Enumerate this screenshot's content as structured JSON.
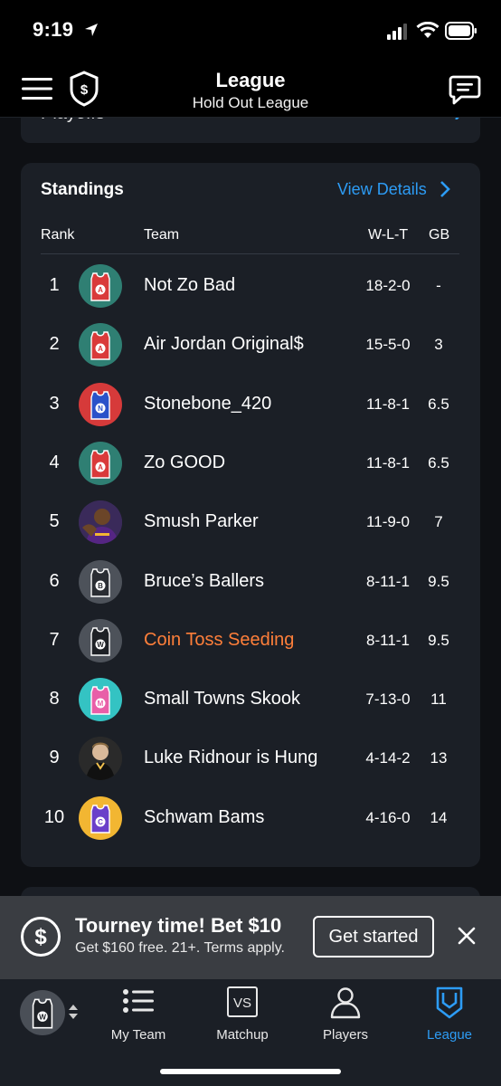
{
  "status_bar": {
    "time": "9:19"
  },
  "header": {
    "title": "League",
    "subtitle": "Hold Out League"
  },
  "playoffs_card": {
    "label": "Playoffs"
  },
  "standings": {
    "title": "Standings",
    "view_details_label": "View Details",
    "columns": {
      "rank": "Rank",
      "team": "Team",
      "wlt": "W-L-T",
      "gb": "GB"
    },
    "rows": [
      {
        "rank": "1",
        "team": "Not Zo Bad",
        "record": "18-2-0",
        "gb": "-",
        "avatar_type": "jersey",
        "avatar_letter": "A",
        "avatar_bg": "#2f7f73",
        "jersey_color": "#d93a3a"
      },
      {
        "rank": "2",
        "team": "Air Jordan Original$",
        "record": "15-5-0",
        "gb": "3",
        "avatar_type": "jersey",
        "avatar_letter": "A",
        "avatar_bg": "#2f7f73",
        "jersey_color": "#d93a3a"
      },
      {
        "rank": "3",
        "team": "Stonebone_420",
        "record": "11-8-1",
        "gb": "6.5",
        "avatar_type": "jersey",
        "avatar_letter": "N",
        "avatar_bg": "#d63a3a",
        "jersey_color": "#2a52c9"
      },
      {
        "rank": "4",
        "team": "Zo GOOD",
        "record": "11-8-1",
        "gb": "6.5",
        "avatar_type": "jersey",
        "avatar_letter": "A",
        "avatar_bg": "#2f7f73",
        "jersey_color": "#d93a3a"
      },
      {
        "rank": "5",
        "team": "Smush Parker",
        "record": "11-9-0",
        "gb": "7",
        "avatar_type": "photo-purple",
        "avatar_letter": "",
        "avatar_bg": "#3a2a5a",
        "jersey_color": "#f2b632"
      },
      {
        "rank": "6",
        "team": "Bruce’s Ballers",
        "record": "8-11-1",
        "gb": "9.5",
        "avatar_type": "jersey",
        "avatar_letter": "B",
        "avatar_bg": "#4d525a",
        "jersey_color": "#2a2d33"
      },
      {
        "rank": "7",
        "team": "Coin Toss Seeding",
        "record": "8-11-1",
        "gb": "9.5",
        "avatar_type": "jersey",
        "avatar_letter": "W",
        "avatar_bg": "#4d525a",
        "jersey_color": "#1e2126",
        "highlight": true
      },
      {
        "rank": "8",
        "team": "Small Towns Skook",
        "record": "7-13-0",
        "gb": "11",
        "avatar_type": "jersey",
        "avatar_letter": "M",
        "avatar_bg": "#34c3c3",
        "jersey_color": "#e85fa8"
      },
      {
        "rank": "9",
        "team": "Luke Ridnour is Hung",
        "record": "4-14-2",
        "gb": "13",
        "avatar_type": "photo-dark",
        "avatar_letter": "",
        "avatar_bg": "#2a2a2a",
        "jersey_color": "#d9c9a8"
      },
      {
        "rank": "10",
        "team": "Schwam Bams",
        "record": "4-16-0",
        "gb": "14",
        "avatar_type": "jersey",
        "avatar_letter": "C",
        "avatar_bg": "#f2b632",
        "jersey_color": "#6a3fc9"
      }
    ]
  },
  "promo": {
    "title": "Tourney time! Bet $10",
    "subtitle": "Get $160 free. 21+. Terms apply.",
    "cta_label": "Get started"
  },
  "tab_bar": {
    "switcher_letter": "W",
    "tabs": [
      {
        "label": "My Team",
        "icon": "list-icon"
      },
      {
        "label": "Matchup",
        "icon": "vs-icon"
      },
      {
        "label": "Players",
        "icon": "person-icon"
      },
      {
        "label": "League",
        "icon": "league-shield-icon",
        "active": true
      }
    ]
  },
  "colors": {
    "accent_blue": "#2d9cf5",
    "highlight_orange": "#ff7f3a",
    "card_bg": "#1b1f26",
    "banner_bg": "#3a3d42"
  }
}
